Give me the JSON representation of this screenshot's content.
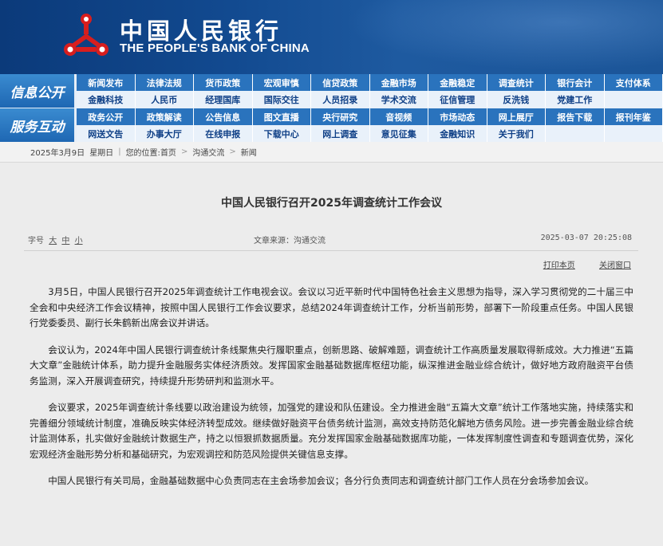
{
  "header": {
    "bank_name_cn": "中国人民银行",
    "bank_name_en": "THE PEOPLE'S BANK OF CHINA",
    "logo_icon": "pboc-emblem-icon",
    "colors": {
      "banner": "#124a90",
      "logo": "#d81e1e"
    }
  },
  "nav": {
    "sections": [
      {
        "label": "信息公开",
        "items": [
          "新闻发布",
          "法律法规",
          "货币政策",
          "宏观审慎",
          "信贷政策",
          "金融市场",
          "金融稳定",
          "调查统计",
          "银行会计",
          "支付体系",
          "金融科技",
          "人民币",
          "经理国库",
          "国际交往",
          "人员招录",
          "学术交流",
          "征信管理",
          "反洗钱",
          "党建工作",
          ""
        ]
      },
      {
        "label": "服务互动",
        "items": [
          "政务公开",
          "政策解读",
          "公告信息",
          "图文直播",
          "央行研究",
          "音视频",
          "市场动态",
          "网上展厅",
          "报告下载",
          "报刊年鉴",
          "网送文告",
          "办事大厅",
          "在线申报",
          "下载中心",
          "网上调查",
          "意见征集",
          "金融知识",
          "关于我们",
          "",
          ""
        ]
      }
    ]
  },
  "breadcrumb": {
    "date": "2025年3月9日",
    "weekday": "星期日",
    "location_label": "您的位置:",
    "home": "首页",
    "level1": "沟通交流",
    "level2": "新闻"
  },
  "article": {
    "title": "中国人民银行召开2025年调查统计工作会议",
    "font_size_label": "字号",
    "font_large": "大",
    "font_medium": "中",
    "font_small": "小",
    "source": "文章来源：沟通交流",
    "datetime": "2025-03-07 20:25:08",
    "print_label": "打印本页",
    "close_label": "关闭窗口",
    "paragraphs": [
      "3月5日，中国人民银行召开2025年调查统计工作电视会议。会议以习近平新时代中国特色社会主义思想为指导，深入学习贯彻党的二十届三中全会和中央经济工作会议精神，按照中国人民银行工作会议要求，总结2024年调查统计工作，分析当前形势，部署下一阶段重点任务。中国人民银行党委委员、副行长朱鹤新出席会议并讲话。",
      "会议认为，2024年中国人民银行调查统计条线聚焦央行履职重点，创新思路、破解难题，调查统计工作高质量发展取得新成效。大力推进“五篇大文章”金融统计体系，助力提升金融服务实体经济质效。发挥国家金融基础数据库枢纽功能，纵深推进金融业综合统计，做好地方政府融资平台债务监测，深入开展调查研究，持续提升形势研判和监测水平。",
      "会议要求，2025年调查统计条线要以政治建设为统领，加强党的建设和队伍建设。全力推进金融“五篇大文章”统计工作落地实施，持续落实和完善细分领域统计制度，准确反映实体经济转型成效。继续做好融资平台债务统计监测，高效支持防范化解地方债务风险。进一步完善金融业综合统计监测体系，扎实做好金融统计数据生产，持之以恒狠抓数据质量。充分发挥国家金融基础数据库功能，一体发挥制度性调查和专题调查优势，深化宏观经济金融形势分析和基础研究，为宏观调控和防范风险提供关键信息支撑。",
      "中国人民银行有关司局，金融基础数据中心负责同志在主会场参加会议；各分行负责同志和调查统计部门工作人员在分会场参加会议。"
    ]
  }
}
